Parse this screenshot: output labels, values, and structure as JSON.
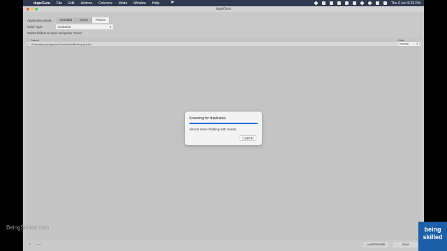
{
  "menubar": {
    "app": "dupeGuru",
    "items": [
      "File",
      "Edit",
      "Actions",
      "Columns",
      "Mode",
      "Window",
      "Help"
    ],
    "clock": "Thu 3 Jun  5:25 PM"
  },
  "window": {
    "title": "dupeGuru",
    "app_mode_label": "Application Mode:",
    "modes": [
      "Standard",
      "Music",
      "Picture"
    ],
    "selected_mode": "Picture",
    "scan_type_label": "Scan Type:",
    "scan_type_value": "Contents",
    "instruction": "Select folders to scan and press \"Scan\".",
    "table": {
      "col_name": "Name",
      "col_state": "State",
      "rows": [
        {
          "path": "/Users/jasonpalgrave/Downloads/Backup photos",
          "state": "Normal"
        }
      ]
    },
    "bottom": {
      "add": "+",
      "remove": "—",
      "load_results": "Load Results",
      "scan": "Scan"
    }
  },
  "dialog": {
    "title": "Scanning for duplicates",
    "progress": 1.0,
    "status": "Almost done! Fiddling with results...",
    "cancel": "Cancel"
  },
  "watermark": "BeingSkilled.com",
  "logo": {
    "line1": "being",
    "line2": "skilled"
  },
  "colors": {
    "accent": "#2a6ad6",
    "menubar": "#2f3a4e",
    "logo": "#1d5fa6"
  }
}
